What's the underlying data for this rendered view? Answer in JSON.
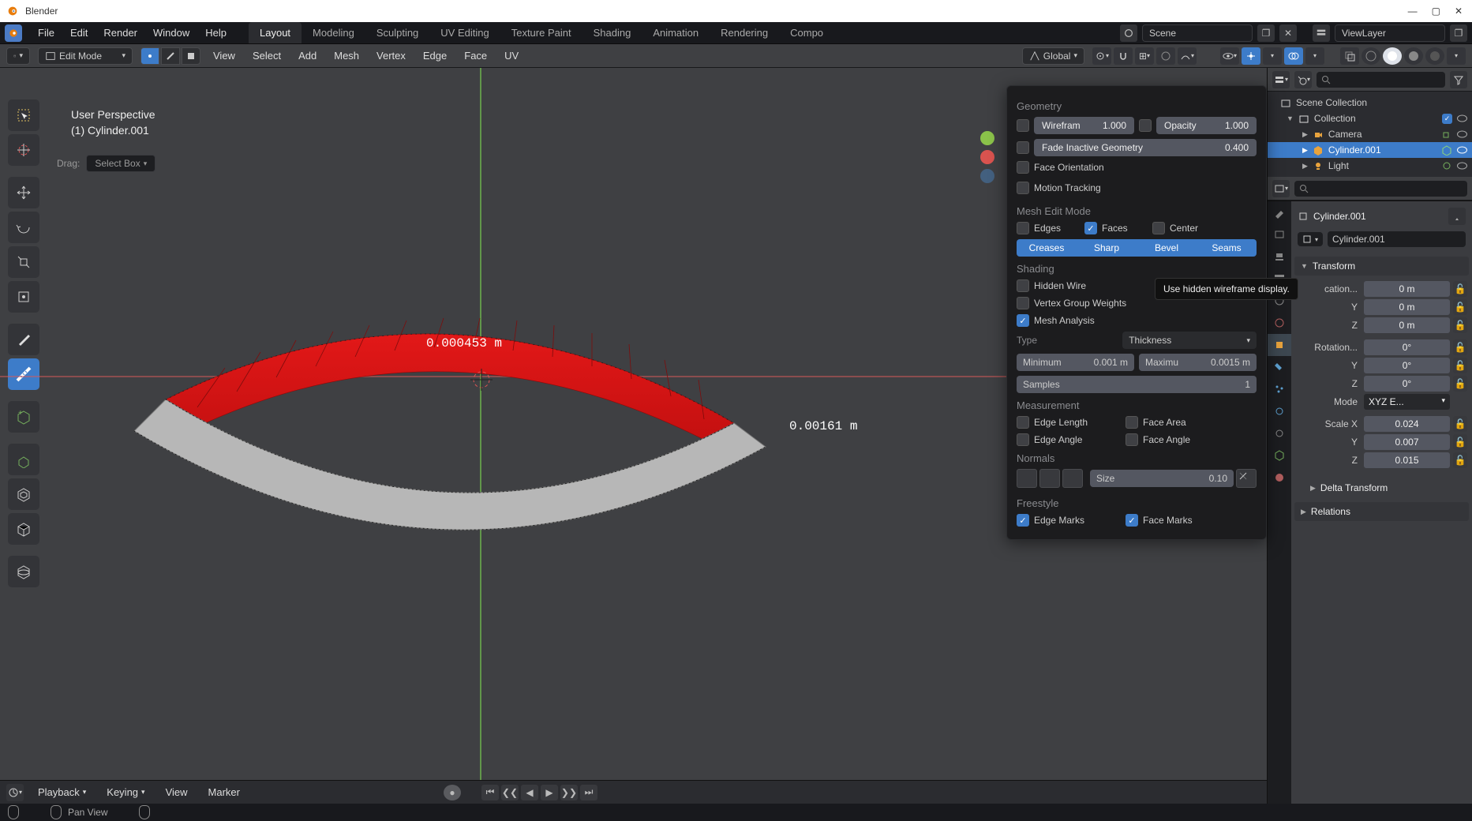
{
  "app": {
    "title": "Blender"
  },
  "menu": {
    "file": "File",
    "edit": "Edit",
    "render": "Render",
    "window": "Window",
    "help": "Help"
  },
  "workspaces": {
    "active": "Layout",
    "items": [
      "Layout",
      "Modeling",
      "Sculpting",
      "UV Editing",
      "Texture Paint",
      "Shading",
      "Animation",
      "Rendering",
      "Compo"
    ]
  },
  "scene": {
    "label": "Scene",
    "viewlayer": "ViewLayer"
  },
  "header": {
    "mode": "Edit Mode",
    "menus": [
      "View",
      "Select",
      "Add",
      "Mesh",
      "Vertex",
      "Edge",
      "Face",
      "UV"
    ],
    "orientation": "Global"
  },
  "drag": {
    "label": "Drag:",
    "value": "Select Box"
  },
  "viewport": {
    "info_line1": "User Perspective",
    "info_line2": "(1) Cylinder.001",
    "measure1": "0.000453 m",
    "measure2": "0.00161 m"
  },
  "overlay": {
    "geometry": "Geometry",
    "wireframe": {
      "label": "Wirefram",
      "value": "1.000"
    },
    "opacity": {
      "label": "Opacity",
      "value": "1.000"
    },
    "fade": {
      "label": "Fade Inactive Geometry",
      "value": "0.400"
    },
    "face_orientation": "Face Orientation",
    "motion_tracking": "Motion Tracking",
    "mesh_edit_mode": "Mesh Edit Mode",
    "edges": "Edges",
    "faces": "Faces",
    "center": "Center",
    "segs": [
      "Creases",
      "Sharp",
      "Bevel",
      "Seams"
    ],
    "shading": "Shading",
    "hidden_wire": "Hidden Wire",
    "vgw": "Vertex Group Weights",
    "mesh_analysis": "Mesh Analysis",
    "type_label": "Type",
    "type_value": "Thickness",
    "minimum": {
      "label": "Minimum",
      "value": "0.001 m"
    },
    "maximum": {
      "label": "Maximu",
      "value": "0.0015 m"
    },
    "samples": {
      "label": "Samples",
      "value": "1"
    },
    "measurement": "Measurement",
    "edge_length": "Edge Length",
    "face_area": "Face Area",
    "edge_angle": "Edge Angle",
    "face_angle": "Face Angle",
    "normals": "Normals",
    "normals_size": {
      "label": "Size",
      "value": "0.10"
    },
    "freestyle": "Freestyle",
    "edge_marks": "Edge Marks",
    "face_marks": "Face Marks",
    "tooltip": "Use hidden wireframe display."
  },
  "outliner": {
    "root": "Scene Collection",
    "collection": "Collection",
    "items": [
      {
        "name": "Camera",
        "icon": "camera"
      },
      {
        "name": "Cylinder.001",
        "icon": "mesh",
        "selected": true
      },
      {
        "name": "Light",
        "icon": "light"
      }
    ]
  },
  "props": {
    "breadcrumb": "Cylinder.001",
    "name": "Cylinder.001",
    "transform": "Transform",
    "location_label": "cation...",
    "rotation_label": "Rotation...",
    "mode_label": "Mode",
    "mode_value": "XYZ E...",
    "scale_label": "Scale X",
    "loc": {
      "x": "0 m",
      "y": "0 m",
      "z": "0 m"
    },
    "rot": {
      "x": "0°",
      "y": "0°",
      "z": "0°"
    },
    "scale": {
      "x": "0.024",
      "y": "0.007",
      "z": "0.015"
    },
    "y": "Y",
    "z": "Z",
    "delta": "Delta Transform",
    "relations": "Relations"
  },
  "timeline": {
    "playback": "Playback",
    "keying": "Keying",
    "view": "View",
    "marker": "Marker"
  },
  "status": {
    "pan": "Pan View"
  }
}
